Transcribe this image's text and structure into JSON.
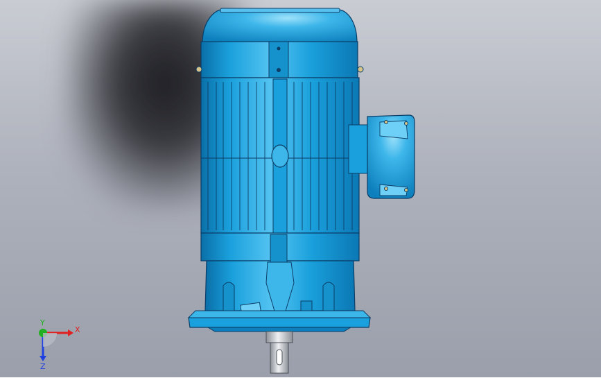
{
  "viewport": {
    "model": "electric-motor-vertical-flange-mount",
    "colors": {
      "body": "#1aa0dc",
      "body_light": "#6fd0f7",
      "body_dark": "#0a6fa8",
      "edge": "#0b3d66",
      "shaft": "#c8ccd2",
      "background_top": "#c9ccd3",
      "background_bottom": "#9a9fab"
    }
  },
  "triad": {
    "x_label": "X",
    "y_label": "Y",
    "z_label": "Z",
    "colors": {
      "x": "#e02020",
      "y": "#20b020",
      "z": "#2040e0"
    }
  }
}
